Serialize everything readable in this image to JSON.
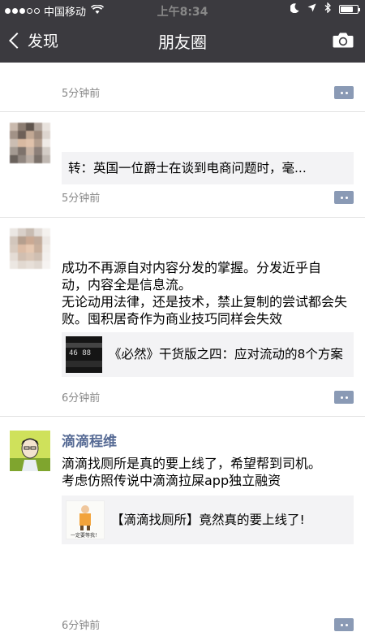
{
  "status_bar": {
    "carrier": "中国移动",
    "time": "上午8:34"
  },
  "nav": {
    "back_label": "发现",
    "title": "朋友圈"
  },
  "posts": [
    {
      "time": "5分钟前"
    },
    {
      "card_title": "转：英国一位爵士在谈到电商问题时，毫...",
      "time": "5分钟前"
    },
    {
      "text_lines": [
        "成功不再源自对内容分发的掌握。分发近乎自",
        "动，内容全是信息流。",
        "无论动用法律，还是技术，禁止复制的尝试都会失败。囤积居奇作为商业技巧同样会失效"
      ],
      "card_title": "《必然》干货版之四：应对流动的8个方案",
      "card_thumb_text": "46 88",
      "time": "6分钟前"
    },
    {
      "nickname": "滴滴程维",
      "text_lines": [
        "滴滴找厕所是真的要上线了，希望帮到司机。",
        "考虑仿照传说中滴滴拉屎app独立融资"
      ],
      "card_title": "【滴滴找厕所】竟然真的要上线了!",
      "card_thumb_text": "一定要等我！",
      "time": "6分钟前"
    }
  ],
  "icons": {
    "back": "chevron-left-icon",
    "camera": "camera-icon",
    "comment": "comment-icon"
  }
}
